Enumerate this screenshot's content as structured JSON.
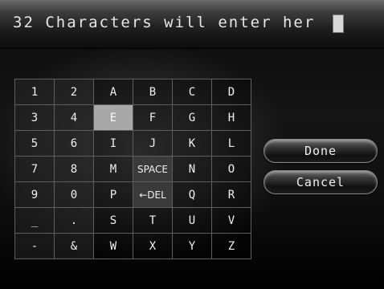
{
  "input": {
    "text": "32 Characters will enter her"
  },
  "keyboard": {
    "rows": [
      [
        "1",
        "2",
        "A",
        "B",
        "C",
        "D"
      ],
      [
        "3",
        "4",
        "E",
        "F",
        "G",
        "H"
      ],
      [
        "5",
        "6",
        "I",
        "J",
        "K",
        "L"
      ],
      [
        "7",
        "8",
        "M",
        "SPACE",
        "N",
        "O"
      ],
      [
        "9",
        "0",
        "P",
        "←DEL",
        "Q",
        "R"
      ],
      [
        "_",
        ".",
        "S",
        "T",
        "U",
        "V"
      ],
      [
        "-",
        "&",
        "W",
        "X",
        "Y",
        "Z"
      ]
    ],
    "selected": "E"
  },
  "buttons": {
    "done": "Done",
    "cancel": "Cancel"
  },
  "colors": {
    "background": "#000000",
    "selected_key": "#a8a8a8",
    "text": "#f0f0f0"
  }
}
